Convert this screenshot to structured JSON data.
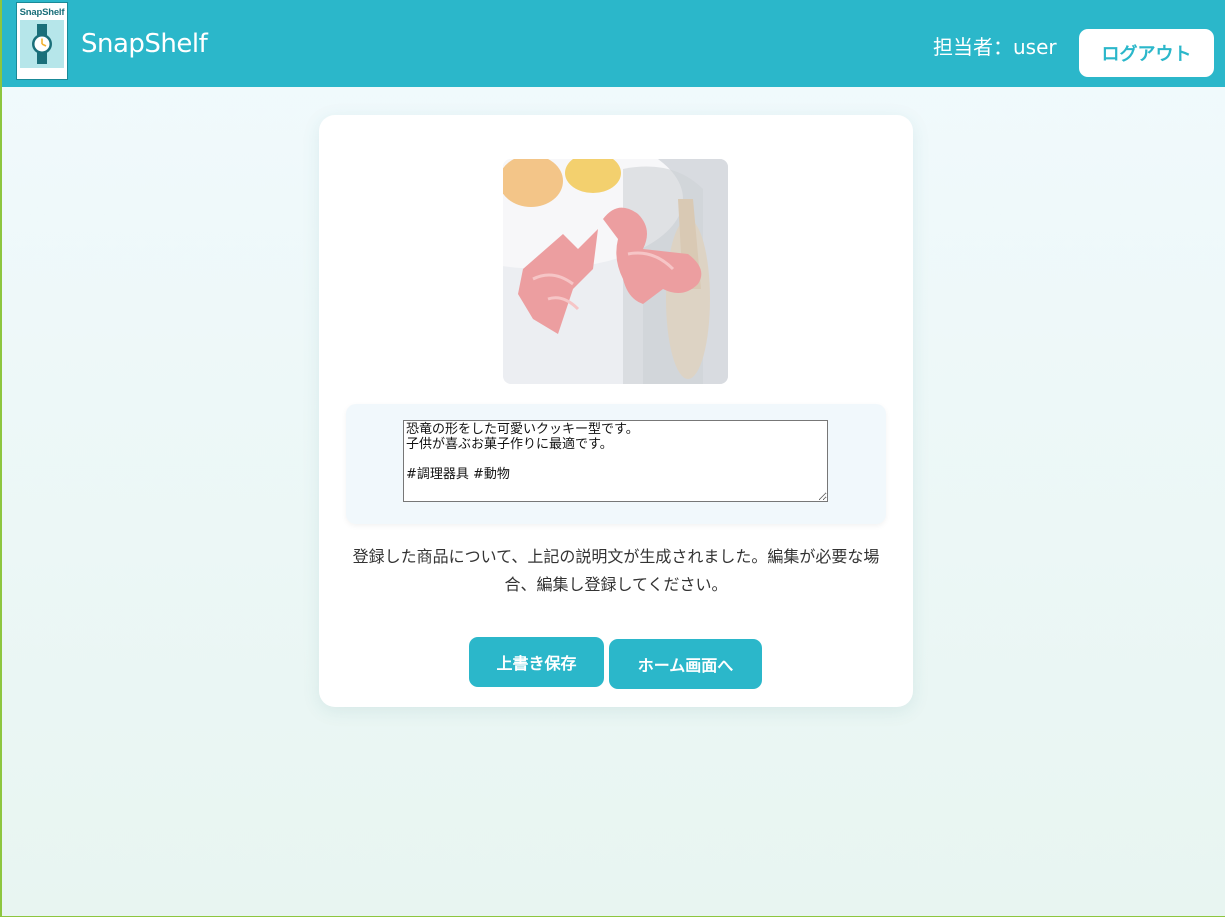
{
  "header": {
    "logo_text": "SnapShelf",
    "app_title": "SnapShelf",
    "user_label": "担当者：user",
    "logout_label": "ログアウト"
  },
  "main": {
    "description_value": "恐竜の形をした可愛いクッキー型です。\n子供が喜ぶお菓子作りに最適です。\n\n#調理器具 #動物",
    "notice": "登録した商品について、上記の説明文が生成されました。編集が必要な場合、編集し登録してください。",
    "save_label": "上書き保存",
    "home_label": "ホーム画面へ"
  },
  "colors": {
    "accent": "#2bb7ca",
    "background": "#eef8f8"
  },
  "icons": {
    "logo": "watch-icon"
  }
}
